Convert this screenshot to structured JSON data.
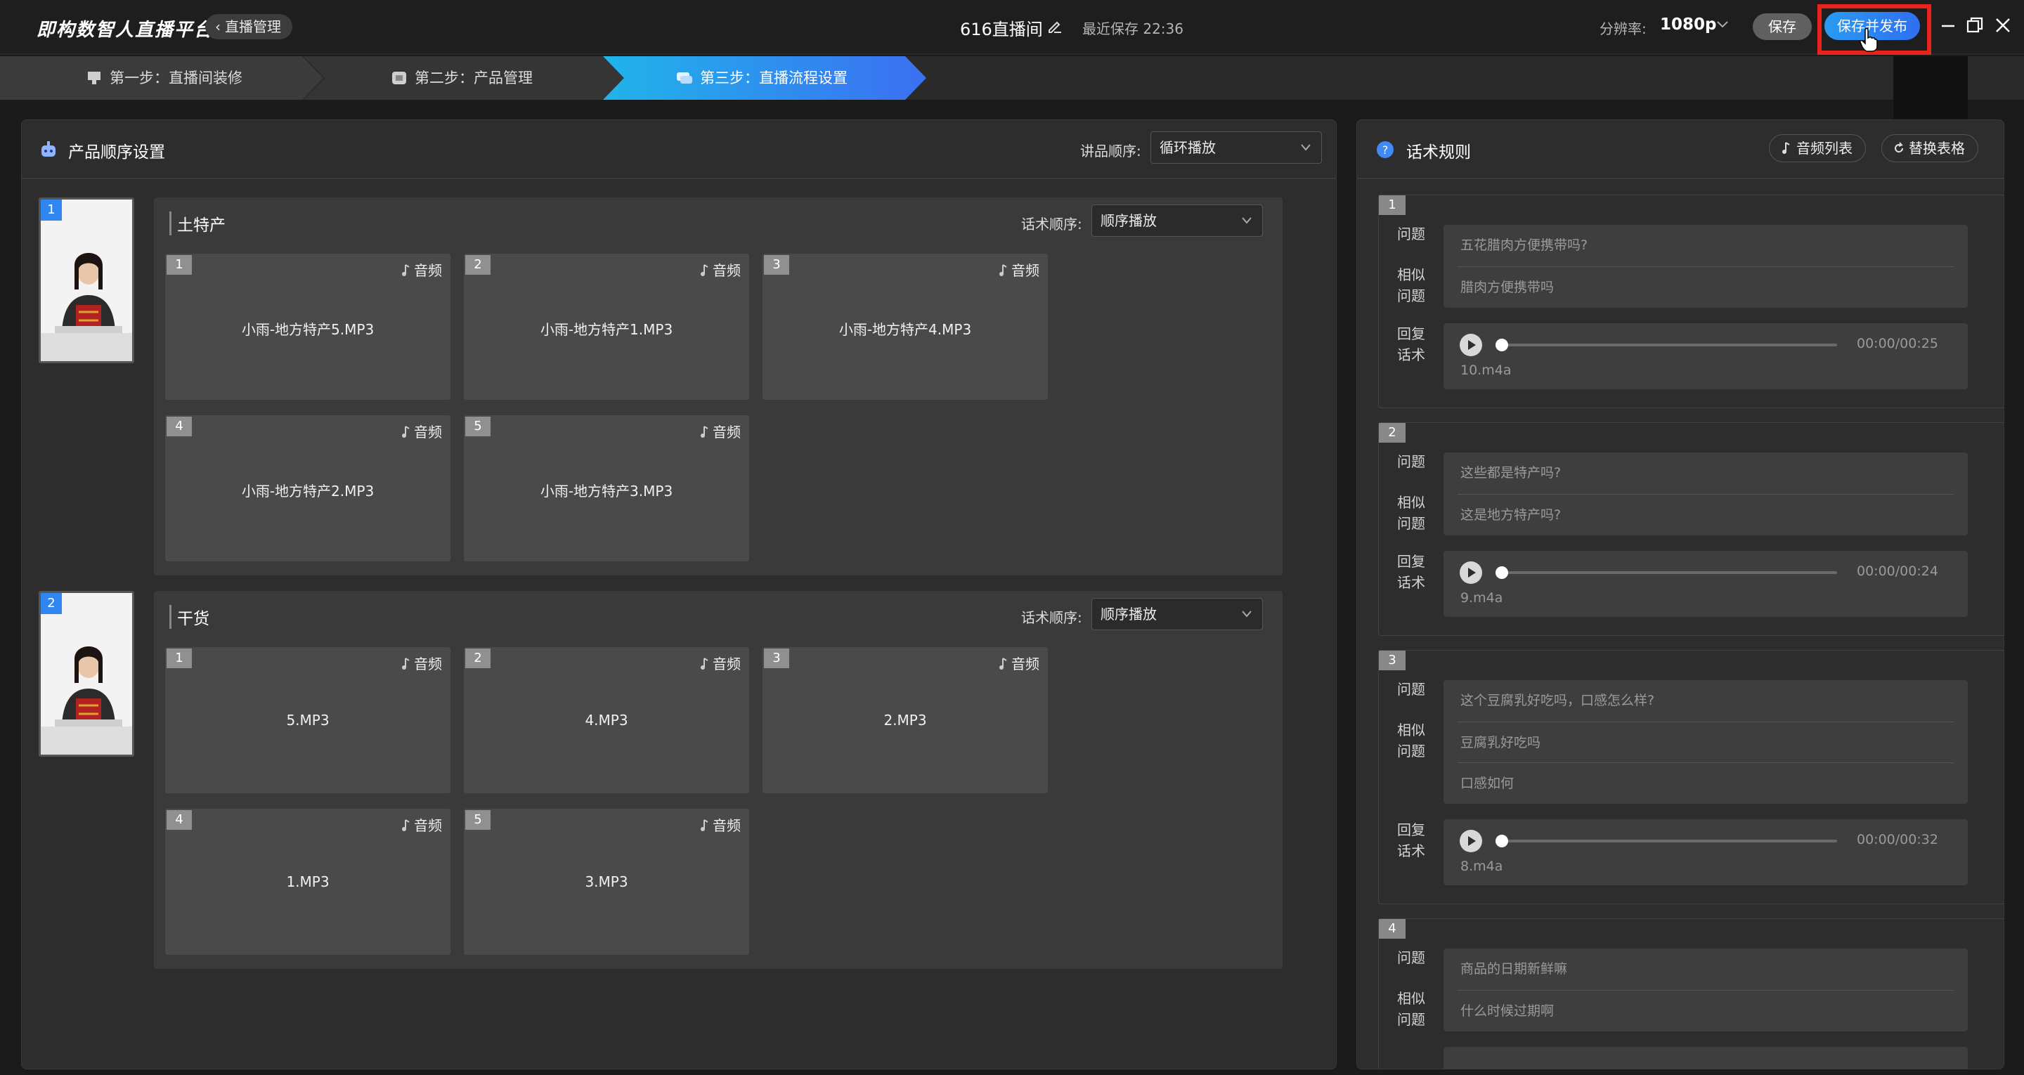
{
  "app": {
    "logo": "即构数智人直播平台",
    "back_label": "直播管理",
    "title": "616直播间",
    "last_save": "最近保存 22:36",
    "resolution_label": "分辨率:",
    "resolution_value": "1080p",
    "save_label": "保存",
    "publish_label": "保存并发布"
  },
  "steps": [
    {
      "label": "第一步：直播间装修",
      "icon": "monitor-icon"
    },
    {
      "label": "第二步：产品管理",
      "icon": "box-icon"
    },
    {
      "label": "第三步：直播流程设置",
      "icon": "chat-icon",
      "active": true
    }
  ],
  "left": {
    "title": "产品顺序设置",
    "order_label": "讲品顺序:",
    "order_value": "循环播放",
    "products": [
      {
        "index": "1",
        "name": "土特产",
        "speech_label": "话术顺序:",
        "speech_value": "顺序播放",
        "cards": [
          {
            "num": "1",
            "tag": "音频",
            "file": "小雨-地方特产5.MP3"
          },
          {
            "num": "2",
            "tag": "音频",
            "file": "小雨-地方特产1.MP3"
          },
          {
            "num": "3",
            "tag": "音频",
            "file": "小雨-地方特产4.MP3"
          },
          {
            "num": "4",
            "tag": "音频",
            "file": "小雨-地方特产2.MP3"
          },
          {
            "num": "5",
            "tag": "音频",
            "file": "小雨-地方特产3.MP3"
          }
        ]
      },
      {
        "index": "2",
        "name": "干货",
        "speech_label": "话术顺序:",
        "speech_value": "顺序播放",
        "cards": [
          {
            "num": "1",
            "tag": "音频",
            "file": "5.MP3"
          },
          {
            "num": "2",
            "tag": "音频",
            "file": "4.MP3"
          },
          {
            "num": "3",
            "tag": "音频",
            "file": "2.MP3"
          },
          {
            "num": "4",
            "tag": "音频",
            "file": "1.MP3"
          },
          {
            "num": "5",
            "tag": "音频",
            "file": "3.MP3"
          }
        ]
      }
    ]
  },
  "right": {
    "title": "话术规则",
    "audio_list_label": "音频列表",
    "replace_label": "替换表格",
    "question_label": "问题",
    "similar_label_1": "相似",
    "similar_label_2": "问题",
    "reply_label_1": "回复",
    "reply_label_2": "话术",
    "rules": [
      {
        "num": "1",
        "question": "五花腊肉方便携带吗?",
        "similar": [
          "腊肉方便携带吗"
        ],
        "time": "00:00/00:25",
        "file": "10.m4a"
      },
      {
        "num": "2",
        "question": "这些都是特产吗?",
        "similar": [
          "这是地方特产吗?"
        ],
        "time": "00:00/00:24",
        "file": "9.m4a"
      },
      {
        "num": "3",
        "question": "这个豆腐乳好吃吗，口感怎么样?",
        "similar": [
          "豆腐乳好吃吗",
          "口感如何"
        ],
        "time": "00:00/00:32",
        "file": "8.m4a"
      },
      {
        "num": "4",
        "question": "商品的日期新鲜嘛",
        "similar": [
          "什么时候过期啊"
        ]
      }
    ]
  },
  "colors": {
    "accent": "#2f86f0",
    "highlight": "#e8231c",
    "active_step": "#2f8ff0"
  }
}
